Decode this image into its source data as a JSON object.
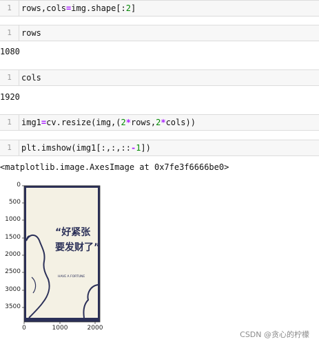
{
  "cells": [
    {
      "line": "1",
      "code": "rows,cols=img.shape[:2]"
    },
    {
      "line": "1",
      "code": "rows",
      "output": "1080"
    },
    {
      "line": "1",
      "code": "cols",
      "output": "1920"
    },
    {
      "line": "1",
      "code": "img1=cv.resize(img,(2*rows,2*cols))"
    },
    {
      "line": "1",
      "code": "plt.imshow(img1[:,:,::-1])",
      "output": "<matplotlib.image.AxesImage at 0x7fe3f6666be0>"
    }
  ],
  "plot": {
    "yticks": [
      "0",
      "500",
      "1000",
      "1500",
      "2000",
      "2500",
      "3000",
      "3500"
    ],
    "xticks": [
      "0",
      "1000",
      "2000"
    ],
    "image_text": {
      "line1": "“好紧张",
      "line2": "要发财了”",
      "line3": "HAVE A FORTUNE"
    },
    "colors": {
      "frame": "#2b3058",
      "paper": "#f4f1e4",
      "ink": "#2b3058"
    }
  },
  "watermark": "CSDN @贪心的柠檬"
}
